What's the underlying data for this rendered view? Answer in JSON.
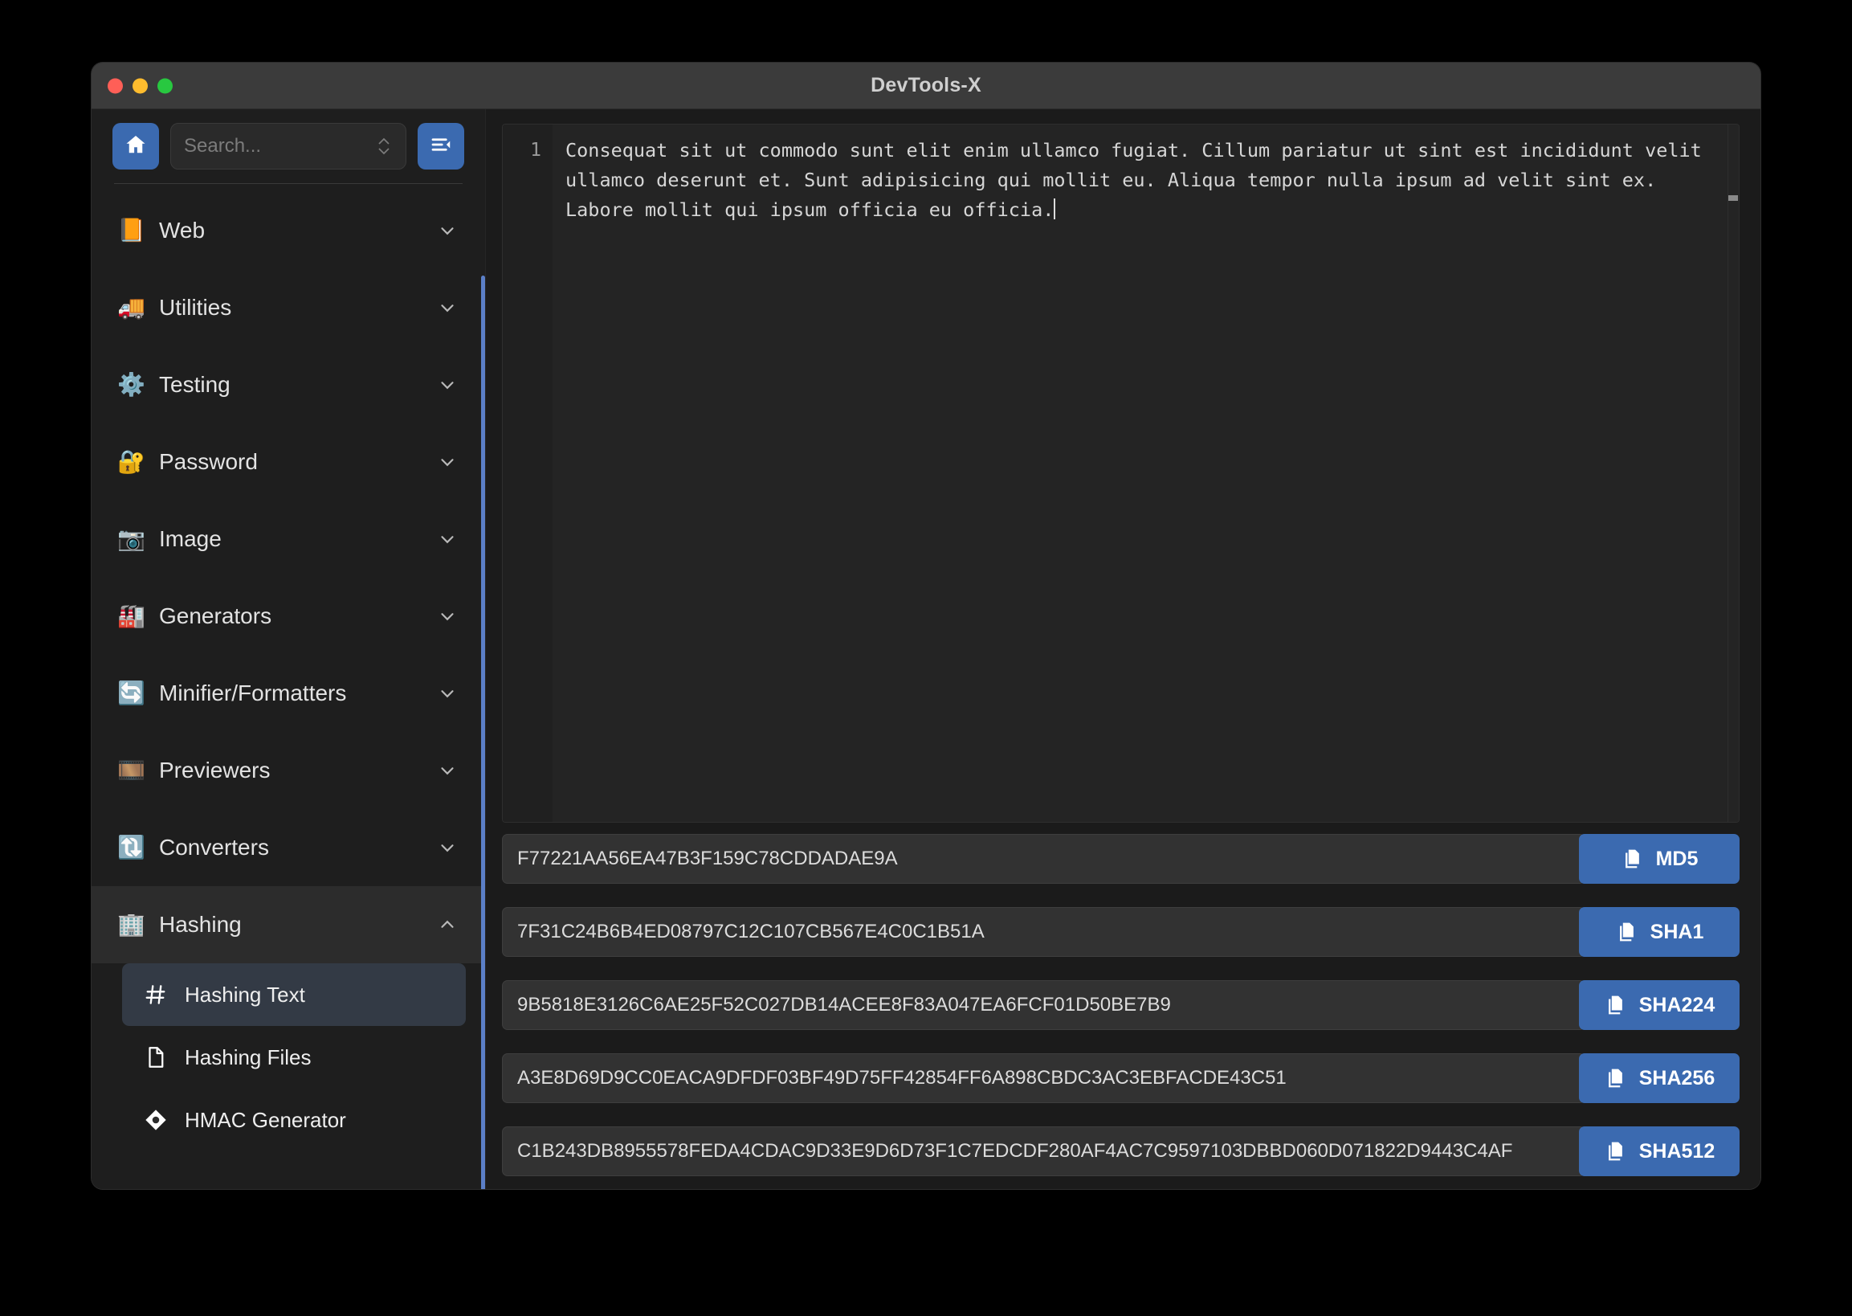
{
  "window": {
    "title": "DevTools-X",
    "traffic_lights": [
      "close",
      "minimize",
      "zoom"
    ]
  },
  "sidebar": {
    "home_button_label": "home",
    "collapse_button_label": "collapse-sidebar",
    "search": {
      "placeholder": "Search...",
      "value": ""
    },
    "groups": [
      {
        "label": "Web",
        "emoji": "📙",
        "icon": "orange-book-icon",
        "expanded": false
      },
      {
        "label": "Utilities",
        "emoji": "🚚",
        "icon": "truck-icon",
        "expanded": false
      },
      {
        "label": "Testing",
        "emoji": "⚙️",
        "icon": "gear-icon",
        "expanded": false
      },
      {
        "label": "Password",
        "emoji": "🔐",
        "icon": "lock-icon",
        "expanded": false
      },
      {
        "label": "Image",
        "emoji": "📷",
        "icon": "camera-icon",
        "expanded": false
      },
      {
        "label": "Generators",
        "emoji": "🏭",
        "icon": "factory-icon",
        "expanded": false
      },
      {
        "label": "Minifier/Formatters",
        "emoji": "🔄",
        "icon": "refresh-icon",
        "expanded": false
      },
      {
        "label": "Previewers",
        "emoji": "🎞️",
        "icon": "film-icon",
        "expanded": false
      },
      {
        "label": "Converters",
        "emoji": "🔃",
        "icon": "convert-arrows-icon",
        "expanded": false
      },
      {
        "label": "Hashing",
        "emoji": "🏢",
        "icon": "building-icon",
        "expanded": true
      }
    ],
    "hashing_items": [
      {
        "label": "Hashing Text",
        "icon": "hash-icon",
        "selected": true
      },
      {
        "label": "Hashing Files",
        "icon": "file-icon",
        "selected": false
      },
      {
        "label": "HMAC Generator",
        "icon": "diamond-icon",
        "selected": false
      }
    ]
  },
  "editor": {
    "line_number": "1",
    "content": "Consequat sit ut commodo sunt elit enim ullamco fugiat. Cillum pariatur ut sint est incididunt velit ullamco deserunt et. Sunt adipisicing qui mollit eu. Aliqua tempor nulla ipsum ad velit sint ex. Labore mollit qui ipsum officia eu officia."
  },
  "hashes": [
    {
      "algorithm": "MD5",
      "value": "F77221AA56EA47B3F159C78CDDADAE9A",
      "copy_icon": "copy-icon"
    },
    {
      "algorithm": "SHA1",
      "value": "7F31C24B6B4ED08797C12C107CB567E4C0C1B51A",
      "copy_icon": "copy-icon"
    },
    {
      "algorithm": "SHA224",
      "value": "9B5818E3126C6AE25F52C027DB14ACEE8F83A047EA6FCF01D50BE7B9",
      "copy_icon": "copy-icon"
    },
    {
      "algorithm": "SHA256",
      "value": "A3E8D69D9CC0EACA9DFDF03BF49D75FF42854FF6A898CBDC3AC3EBFACDE43C51",
      "copy_icon": "copy-icon"
    },
    {
      "algorithm": "SHA512",
      "value": "C1B243DB8955578FEDA4CDAC9D33E9D6D73F1C7EDCDF280AF4AC7C9597103DBBD060D071822D9443C4AF",
      "copy_icon": "copy-icon"
    }
  ],
  "colors": {
    "accent": "#3b6ab0",
    "window_bg": "#1e1e1e",
    "panel_bg": "#1b1b1b",
    "field_bg": "#323232",
    "scrollbar": "#5b7fc7",
    "titlebar": "#3b3b3b"
  }
}
